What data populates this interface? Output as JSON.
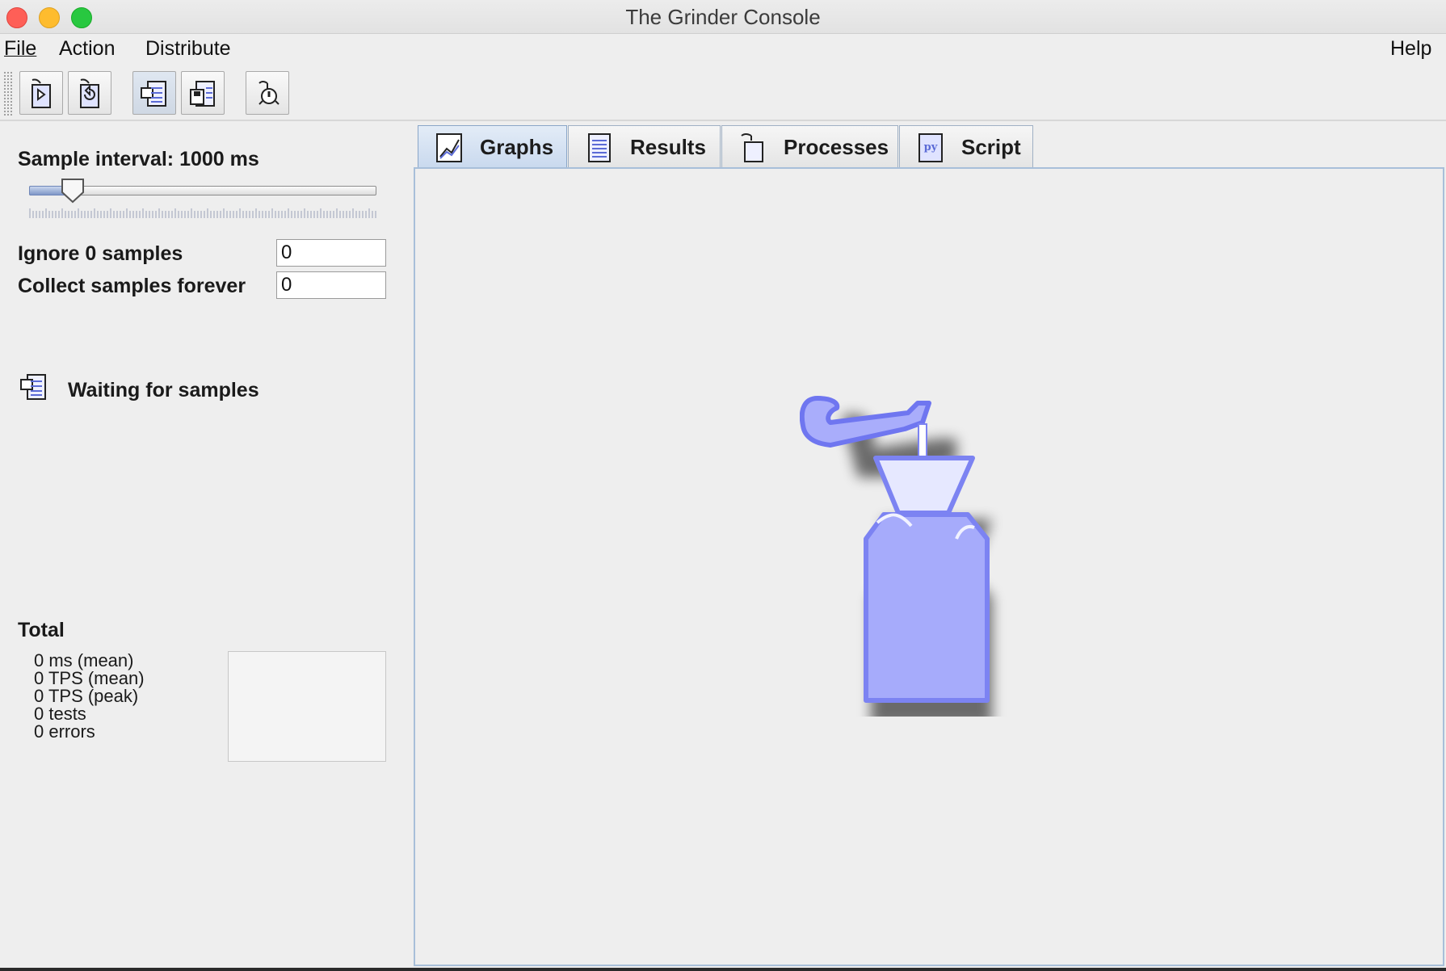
{
  "window": {
    "title": "The Grinder Console"
  },
  "menu": {
    "file": "File",
    "action": "Action",
    "distribute": "Distribute",
    "help": "Help"
  },
  "toolbar": {
    "buttons": [
      {
        "name": "start-processes-button",
        "icon": "start-processes-icon"
      },
      {
        "name": "reset-processes-button",
        "icon": "reset-processes-icon"
      },
      {
        "name": "start-recording-button",
        "icon": "record-stats-icon"
      },
      {
        "name": "save-results-button",
        "icon": "save-icon"
      },
      {
        "name": "stop-processes-button",
        "icon": "stop-processes-icon"
      }
    ]
  },
  "left_panel": {
    "sample_interval_label": "Sample interval: 1000 ms",
    "sample_interval_slider_fraction": 0.07,
    "ignore_label": "Ignore 0 samples",
    "ignore_value": "0",
    "collect_label": "Collect samples forever",
    "collect_value": "0",
    "status_text": "Waiting for samples",
    "total_label": "Total",
    "totals": [
      "0 ms (mean)",
      "0 TPS (mean)",
      "0 TPS (peak)",
      "0 tests",
      "0 errors"
    ]
  },
  "tabs": [
    {
      "label": "Graphs",
      "icon": "graphs-icon",
      "active": true
    },
    {
      "label": "Results",
      "icon": "results-icon",
      "active": false
    },
    {
      "label": "Processes",
      "icon": "processes-icon",
      "active": false
    },
    {
      "label": "Script",
      "icon": "script-icon",
      "active": false
    }
  ],
  "colors": {
    "accent": "#8f96f5",
    "tab_active": "#c9d9ee",
    "border": "#a8bfd9"
  }
}
